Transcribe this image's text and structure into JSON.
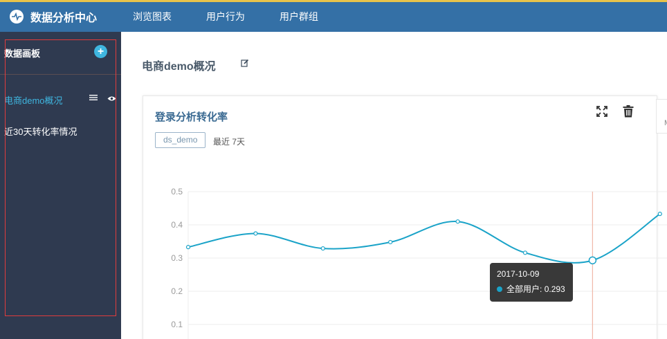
{
  "header": {
    "app_title": "数据分析中心",
    "nav": [
      "浏览图表",
      "用户行为",
      "用户群组"
    ]
  },
  "sidebar": {
    "title": "数据画板",
    "items": [
      {
        "label": "电商demo概况",
        "active": true
      },
      {
        "label": "近30天转化率情况",
        "active": false
      }
    ]
  },
  "main": {
    "title": "电商demo概况",
    "card": {
      "title": "登录分析转化率",
      "tag": "ds_demo",
      "range": "最近 7天"
    },
    "side_card_letter": "M"
  },
  "tooltip": {
    "date": "2017-10-09",
    "series": "全部用户",
    "value": "0.293"
  },
  "colors": {
    "topbar": "#3470a6",
    "sidebar": "#2f3a50",
    "accent": "#3fb6e0",
    "line": "#1aa3c8",
    "crosshair": "#f0b8a8"
  },
  "chart_data": {
    "type": "line",
    "y_ticks": [
      "0.5",
      "0.4",
      "0.3",
      "0.2",
      "0.1"
    ],
    "ylim": [
      0,
      0.5
    ],
    "series": [
      {
        "name": "全部用户",
        "values": [
          0.333,
          0.374,
          0.329,
          0.348,
          0.41,
          0.316,
          0.293,
          0.433
        ]
      }
    ],
    "highlight_index": 6,
    "highlight_x_label": "2017-10-09",
    "grid": true
  }
}
